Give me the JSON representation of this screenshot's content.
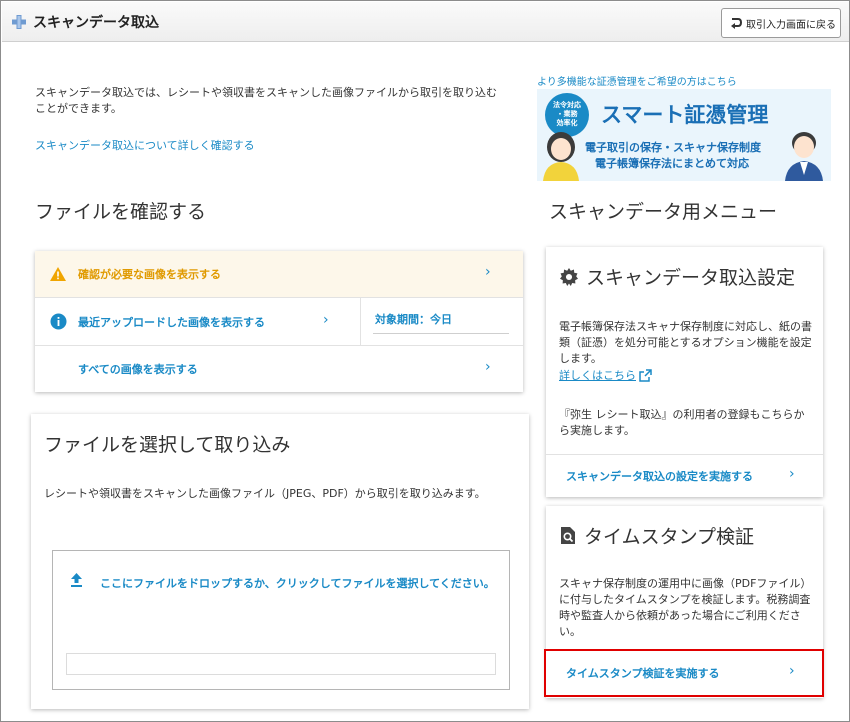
{
  "header": {
    "title": "スキャンデータ取込",
    "back_button_label": "取引入力画面に戻る"
  },
  "intro": {
    "description": "スキャンデータ取込では、レシートや領収書をスキャンした画像ファイルから取引を取り込むことができます。",
    "detail_link": "スキャンデータ取込について詳しく確認する"
  },
  "banner": {
    "caption": "より多機能な証憑管理をご希望の方はこちら",
    "badge_line1": "法令対応",
    "badge_line2": "・業務",
    "badge_line3": "効率化",
    "title": "スマート証憑管理",
    "line1": "電子取引の保存・スキャナ保存制度",
    "line2": "電子帳簿保存法にまとめて対応"
  },
  "check_files": {
    "heading": "ファイルを確認する",
    "needs_review": "確認が必要な画像を表示する",
    "recent_uploads": "最近アップロードした画像を表示する",
    "period_label": "対象期間：今日",
    "all_images": "すべての画像を表示する"
  },
  "select_files": {
    "heading": "ファイルを選択して取り込み",
    "description": "レシートや領収書をスキャンした画像ファイル（JPEG、PDF）から取引を取り込みます。",
    "drop_text": "ここにファイルをドロップするか、クリックしてファイルを選択してください。"
  },
  "scan_menu": {
    "heading": "スキャンデータ用メニュー",
    "settings": {
      "title": "スキャンデータ取込設定",
      "description": "電子帳簿保存法スキャナ保存制度に対応し、紙の書類（証憑）を処分可能とするオプション機能を設定します。",
      "detail_link": "詳しくはこちら",
      "note": "『弥生 レシート取込』の利用者の登録もこちらから実施します。",
      "action": "スキャンデータ取込の設定を実施する"
    },
    "timestamp": {
      "title": "タイムスタンプ検証",
      "description": "スキャナ保存制度の運用中に画像（PDFファイル）に付与したタイムスタンプを検証します。税務調査時や監査人から依頼があった場合にご利用ください。",
      "action": "タイムスタンプ検証を実施する"
    }
  },
  "colors": {
    "accent": "#1a8ac6",
    "warning": "#e09a00",
    "highlight_border": "#e00000"
  },
  "icons": [
    "plus-icon",
    "return-arrow-icon",
    "warning-icon",
    "info-icon",
    "gear-icon",
    "external-link-icon",
    "search-document-icon",
    "upload-icon",
    "chevron-right-icon"
  ]
}
